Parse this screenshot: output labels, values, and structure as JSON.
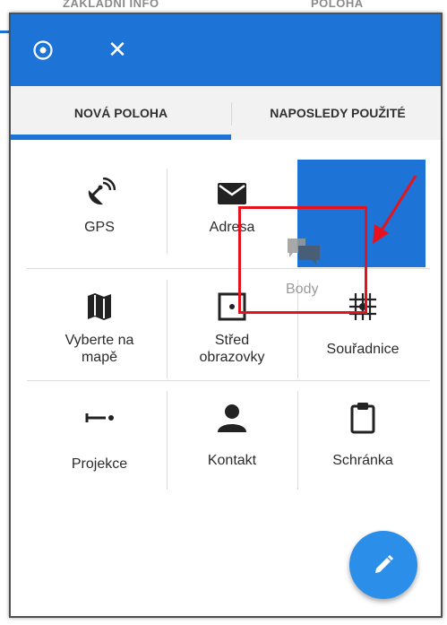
{
  "backdrop": {
    "tab_left": "ZÁKLADNÍ INFO",
    "tab_right": "POLOHA"
  },
  "appbar": {
    "target_icon": "target-icon",
    "close_icon": "close-icon",
    "close_glyph": "✕"
  },
  "tabs": [
    {
      "label": "NOVÁ POLOHA",
      "selected": true
    },
    {
      "label": "NAPOSLEDY POUŽITÉ",
      "selected": false
    }
  ],
  "grid": [
    {
      "label": "GPS",
      "icon": "satellite-dish-icon"
    },
    {
      "label": "Adresa",
      "icon": "envelope-icon"
    },
    {
      "label": "Body",
      "icon": "points-icon",
      "state": "dragging"
    },
    {
      "label": "Vyberte na mapě",
      "line1": "Vyberte na",
      "line2": "mapě",
      "icon": "map-icon"
    },
    {
      "label": "Střed obrazovky",
      "line1": "Střed",
      "line2": "obrazovky",
      "icon": "screen-center-icon"
    },
    {
      "label": "Souřadnice",
      "icon": "coordinates-grid-icon"
    },
    {
      "label": "Projekce",
      "icon": "projection-icon"
    },
    {
      "label": "Kontakt",
      "icon": "contact-icon"
    },
    {
      "label": "Schránka",
      "icon": "clipboard-icon"
    }
  ],
  "fab": {
    "icon": "pencil-icon"
  },
  "colors": {
    "accent": "#1d73d6",
    "fab": "#2b8fea",
    "annotation": "#e8121c"
  }
}
